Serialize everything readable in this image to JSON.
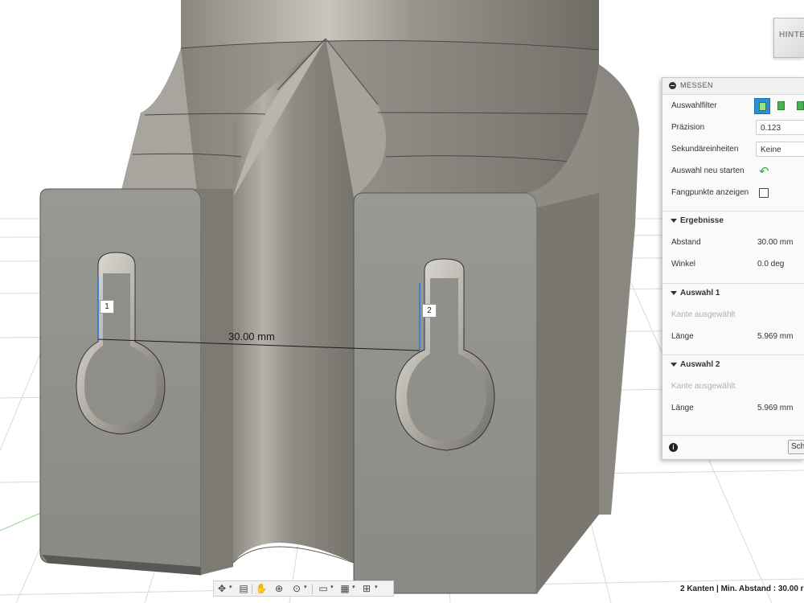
{
  "viewcube": {
    "label": "HINTEN"
  },
  "panel": {
    "title": "MESSEN",
    "rows": {
      "filter_label": "Auswahlfilter",
      "precision_label": "Präzision",
      "precision_value": "0.123",
      "secondary_units_label": "Sekundäreinheiten",
      "secondary_units_value": "Keine",
      "restart_label": "Auswahl neu starten",
      "snap_points_label": "Fangpunkte anzeigen",
      "snap_points_checked": false
    },
    "results": {
      "title": "Ergebnisse",
      "distance_label": "Abstand",
      "distance_value": "30.00 mm",
      "angle_label": "Winkel",
      "angle_value": "0.0 deg"
    },
    "selection1": {
      "title": "Auswahl 1",
      "selected": "Kante ausgewählt",
      "length_label": "Länge",
      "length_value": "5.969 mm"
    },
    "selection2": {
      "title": "Auswahl 2",
      "selected": "Kante ausgewählt",
      "length_label": "Länge",
      "length_value": "5.969 mm"
    },
    "footer": {
      "close_label": "Sch"
    }
  },
  "viewport": {
    "dimension_label": "30.00 mm",
    "marker1": "1",
    "marker2": "2"
  },
  "toolbar": {
    "icons": [
      "orbit-icon",
      "look-at-icon",
      "pan-hand-icon",
      "zoom-icon",
      "fit-icon",
      "display-icon",
      "grid-icon",
      "viewports-icon"
    ]
  },
  "status": {
    "text": "2 Kanten | Min. Abstand : 30.00 r"
  },
  "colors": {
    "accent": "#2a8fd6",
    "model": "#8c8c86",
    "measure_line": "#3b7fd6"
  }
}
